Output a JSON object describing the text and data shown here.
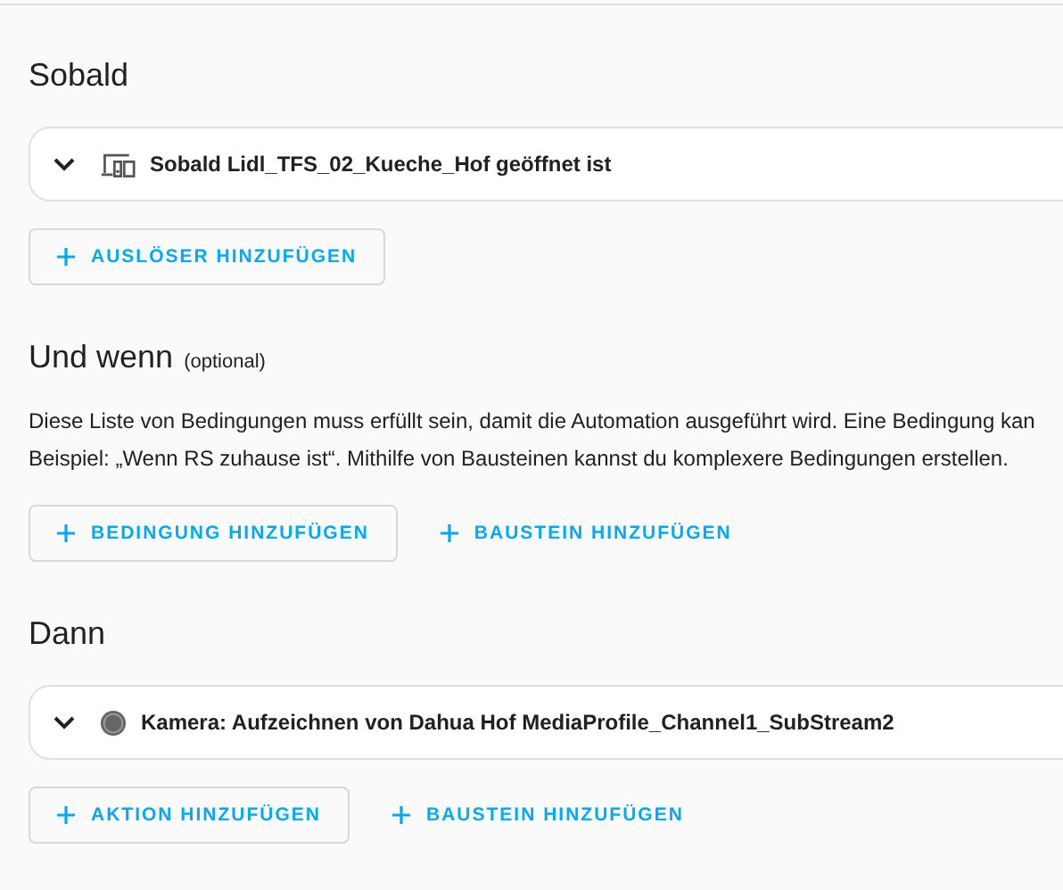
{
  "sections": [
    {
      "title": "Sobald",
      "cards": [
        {
          "kind": "device",
          "label": "Sobald Lidl_TFS_02_Kueche_Hof geöffnet ist",
          "expanded": false
        }
      ],
      "buttons": [
        {
          "kind": "outlined",
          "label": "AUSLÖSER HINZUFÜGEN"
        }
      ]
    },
    {
      "title": "Und wenn",
      "note": "(optional)",
      "description": [
        "Diese Liste von Bedingungen muss erfüllt sein, damit die Automation ausgeführt wird. Eine Bedingung kan",
        "Beispiel: „Wenn RS zuhause ist“. Mithilfe von Bausteinen kannst du komplexere Bedingungen erstellen."
      ],
      "buttons": [
        {
          "kind": "outlined",
          "label": "BEDINGUNG HINZUFÜGEN"
        },
        {
          "kind": "text",
          "label": "BAUSTEIN HINZUFÜGEN"
        }
      ]
    },
    {
      "title": "Dann",
      "cards": [
        {
          "kind": "record",
          "label": "Kamera: Aufzeichnen von Dahua Hof MediaProfile_Channel1_SubStream2",
          "expanded": false
        }
      ],
      "buttons": [
        {
          "kind": "outlined",
          "label": "AKTION HINZUFÜGEN"
        },
        {
          "kind": "text",
          "label": "BAUSTEIN HINZUFÜGEN"
        }
      ]
    }
  ]
}
